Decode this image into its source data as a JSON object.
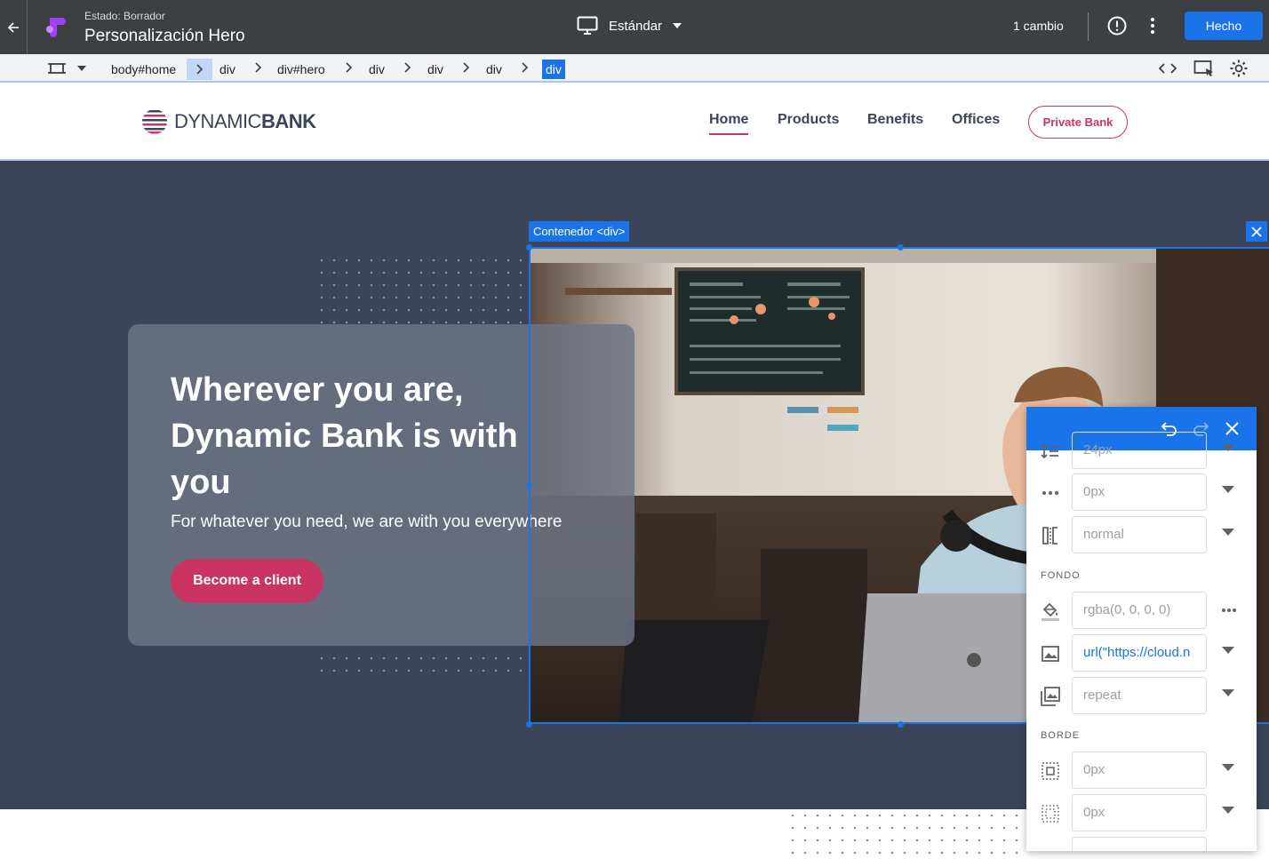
{
  "topbar": {
    "status": "Estado: Borrador",
    "title": "Personalización Hero",
    "device_label": "Estándar",
    "changes": "1 cambio",
    "done_label": "Hecho"
  },
  "breadcrumb": [
    "body#home",
    "div",
    "div#hero",
    "div",
    "div",
    "div",
    "div"
  ],
  "site": {
    "brand_light": "DYNAMIC",
    "brand_bold": "BANK",
    "nav": [
      "Home",
      "Products",
      "Benefits",
      "Offices"
    ],
    "private_bank": "Private Bank"
  },
  "hero": {
    "headline": "Wherever you are, Dynamic Bank is with you",
    "subline": "For whatever you need, we are with you everywhere",
    "cta": "Become a client"
  },
  "selection": {
    "label": "Contenedor <div>"
  },
  "panel": {
    "rows_top": [
      {
        "icon": "line-height-icon",
        "value": "24px"
      },
      {
        "icon": "letter-spacing-icon",
        "value": "0px"
      },
      {
        "icon": "word-break-icon",
        "value": "normal"
      }
    ],
    "section_background": "FONDO",
    "rows_bg": [
      {
        "icon": "fill-color-icon",
        "value": "rgba(0, 0, 0, 0)"
      },
      {
        "icon": "image-icon",
        "value": "url(\"https://cloud.n"
      },
      {
        "icon": "image-repeat-icon",
        "value": "repeat"
      }
    ],
    "section_border": "BORDE",
    "rows_border": [
      {
        "icon": "border-width-icon",
        "value": "0px"
      },
      {
        "icon": "border-radius-icon",
        "value": "0px"
      }
    ]
  },
  "colors": {
    "accent": "#1a73e8",
    "brand": "#c93463",
    "hero_bg": "#3c4459"
  }
}
